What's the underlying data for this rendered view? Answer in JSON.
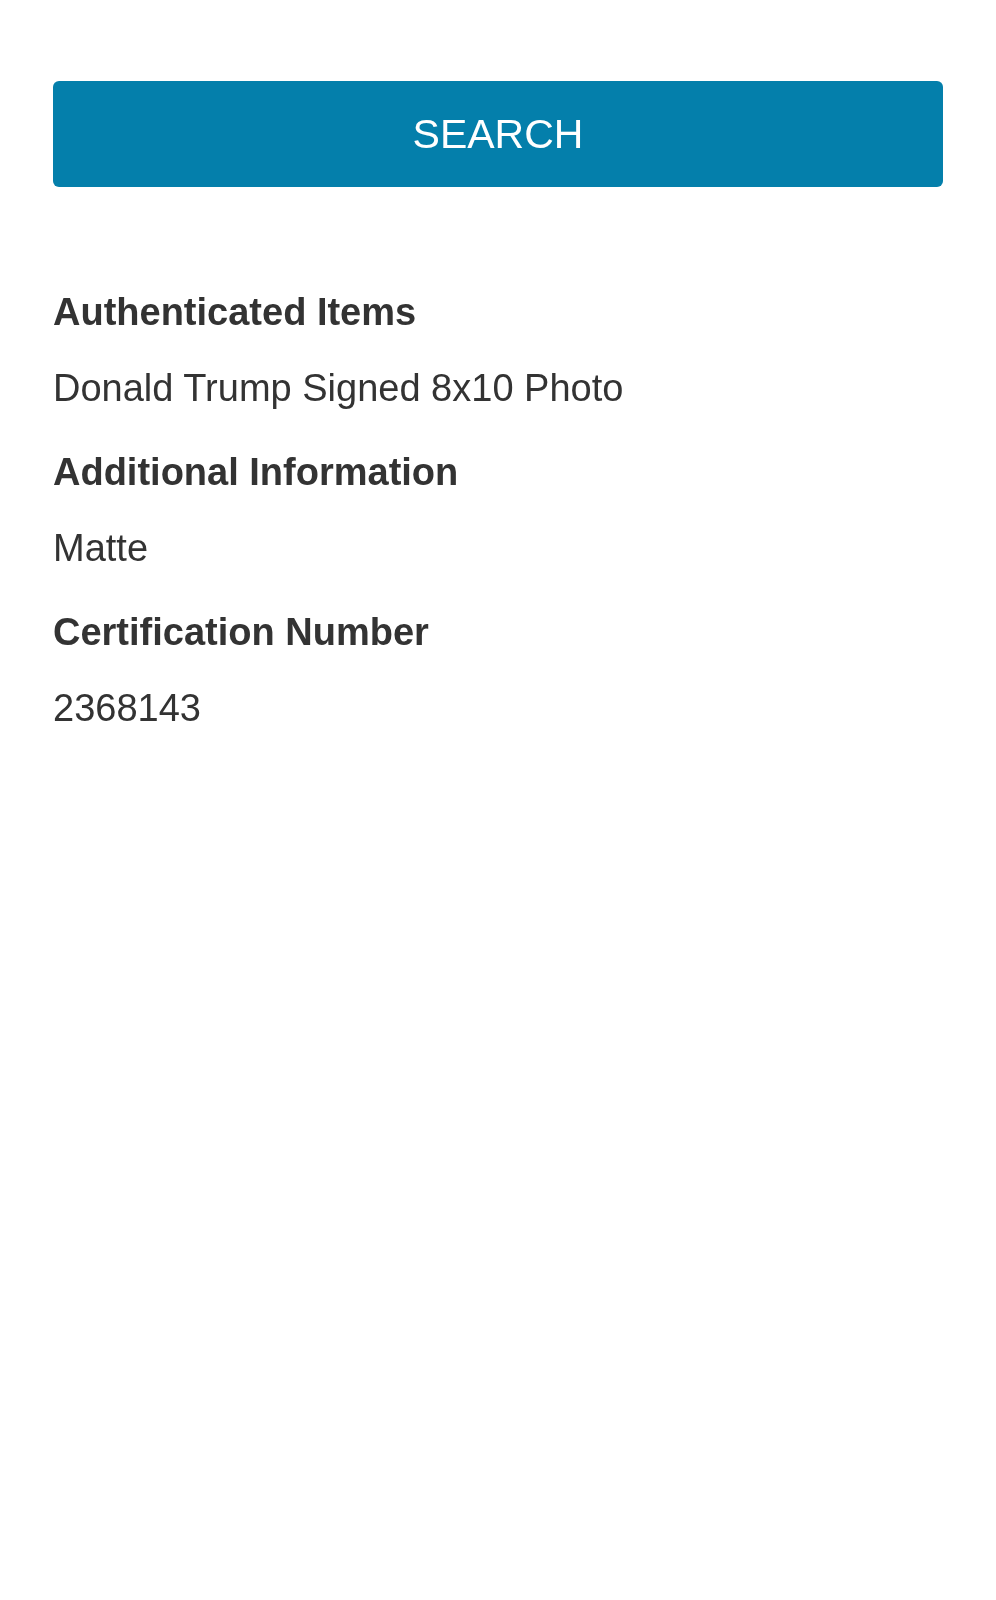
{
  "search_button": {
    "label": "SEARCH"
  },
  "details": [
    {
      "label": "Authenticated Items",
      "value": "Donald Trump Signed 8x10 Photo"
    },
    {
      "label": "Additional Information",
      "value": "Matte"
    },
    {
      "label": "Certification Number",
      "value": "2368143"
    }
  ]
}
